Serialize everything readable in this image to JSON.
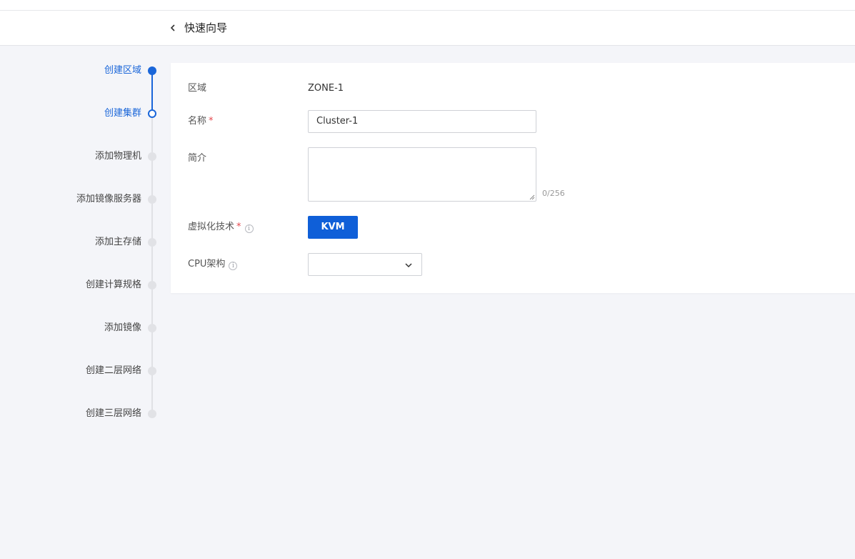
{
  "header": {
    "title": "快速向导",
    "back_icon": "chevron-left-icon"
  },
  "stepper": {
    "steps": [
      {
        "label": "创建区域",
        "state": "done"
      },
      {
        "label": "创建集群",
        "state": "current"
      },
      {
        "label": "添加物理机",
        "state": "pending"
      },
      {
        "label": "添加镜像服务器",
        "state": "pending"
      },
      {
        "label": "添加主存储",
        "state": "pending"
      },
      {
        "label": "创建计算规格",
        "state": "pending"
      },
      {
        "label": "添加镜像",
        "state": "pending"
      },
      {
        "label": "创建二层网络",
        "state": "pending"
      },
      {
        "label": "创建三层网络",
        "state": "pending"
      }
    ],
    "accent_color": "#1a66d9"
  },
  "form": {
    "zone": {
      "label": "区域",
      "value": "ZONE-1"
    },
    "name": {
      "label": "名称",
      "required_mark": "*",
      "value": "Cluster-1"
    },
    "description": {
      "label": "简介",
      "value": "",
      "counter": "0/256"
    },
    "virtualization": {
      "label": "虚拟化技术",
      "required_mark": "*",
      "info_icon": "info-icon",
      "option": "KVM"
    },
    "cpu_arch": {
      "label": "CPU架构",
      "info_icon": "info-icon",
      "value": ""
    }
  }
}
